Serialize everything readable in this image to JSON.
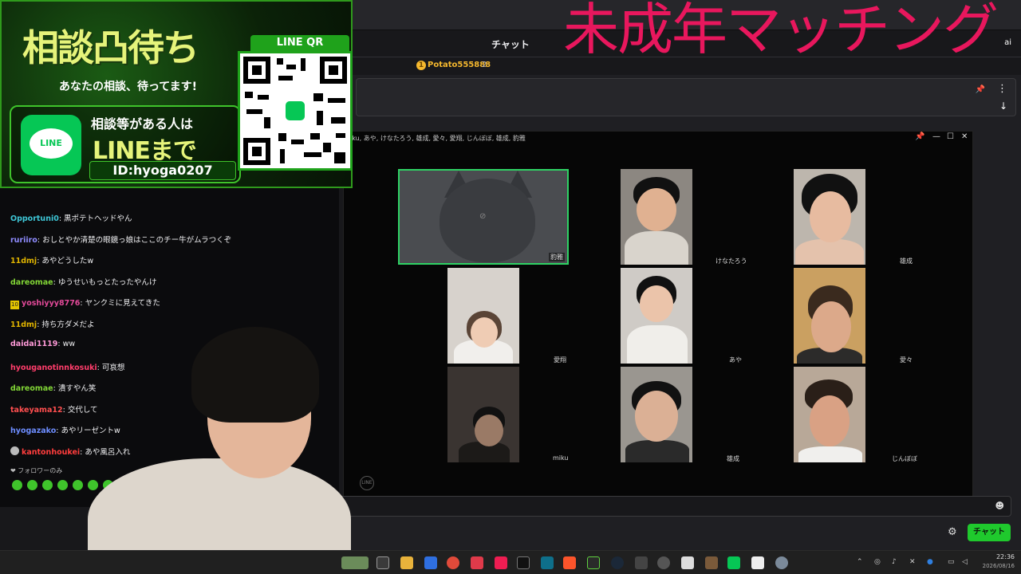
{
  "overlay_title": "未成年マッチング",
  "twitch": {
    "chat_header": "チャット",
    "leader_name": "Potato555888",
    "leader_count": "2",
    "chat_button": "チャット"
  },
  "line_call": {
    "participants_title": "iku, あや, けなたろう, 雄成, 愛々, 愛翔, じんぼぼ, 雄成, 豹雅",
    "tiles": [
      {
        "name": "豹雅"
      },
      {
        "name": "けなたろう"
      },
      {
        "name": "雄成"
      },
      {
        "name": "愛翔"
      },
      {
        "name": "あや"
      },
      {
        "name": "愛々"
      },
      {
        "name": "miku"
      },
      {
        "name": "雄成"
      },
      {
        "name": "じんぼぼ"
      }
    ]
  },
  "ad": {
    "heading": "相談凸待ち",
    "sub": "あなたの相談、待ってます!",
    "line_word": "LINE",
    "text1": "相談等がある人は",
    "text2": "LINEまで",
    "id": "ID:hyoga0207",
    "qr_label": "LINE QR"
  },
  "left_chat": {
    "messages": [
      {
        "user": "Opportuni0",
        "text": ": 黒ポテトヘッドやん",
        "color": "#3ec6d6"
      },
      {
        "user": "ruriiro",
        "text": ": おしとやか清楚の眼鏡っ娘はここのチー牛がムラつくぞ",
        "color": "#8f8cff"
      },
      {
        "user": "11dmj",
        "text": ": あやどうしたw",
        "color": "#e0b400"
      },
      {
        "user": "dareomae",
        "text": ": ゆうせいもっとたったやんけ",
        "color": "#82d636"
      },
      {
        "user": "yoshiyyy8776",
        "text": ": ヤンクミに見えてきた",
        "color": "#e44a9a",
        "badge": "10"
      },
      {
        "user": "11dmj",
        "text": ": 持ち方ダメだよ",
        "color": "#e0b400"
      },
      {
        "user": "daidai1119",
        "text": ": ww",
        "color": "#ff9ad8"
      },
      {
        "user": "hyouganotinnkosuki",
        "text": ": 可哀想",
        "color": "#ff3d6b"
      },
      {
        "user": "dareomae",
        "text": ": 潰すやん笑",
        "color": "#82d636"
      },
      {
        "user": "takeyama12",
        "text": ": 交代して",
        "color": "#ff4f4f"
      },
      {
        "user": "hyogazako",
        "text": ": あやリーゼントw",
        "color": "#6d8dff"
      },
      {
        "user": "kantonhoukei",
        "text": ": あや風呂入れ",
        "color": "#ff3d3d",
        "avatar": true
      }
    ],
    "follower_only": "❤ フォロワーのみ"
  },
  "taskbar": {
    "time": "22:36",
    "date": "2026/08/16"
  }
}
